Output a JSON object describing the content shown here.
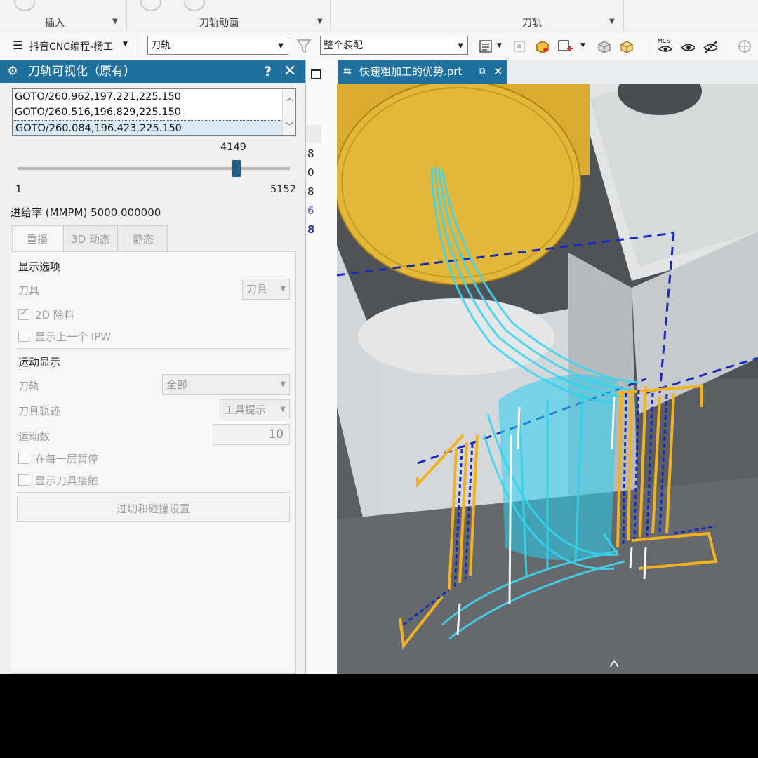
{
  "ribbon": {
    "group_insert": "插入",
    "group_animation": "刀轨动画",
    "group_toolpath": "刀轨"
  },
  "toolbar": {
    "menu_label": "抖音CNC编程-杨工",
    "filter_select": "刀轨",
    "scope_select": "整个装配"
  },
  "dialog": {
    "title": "刀轨可视化（原有）",
    "goto_rows": [
      "GOTO/260.962,197.221,225.150",
      "GOTO/260.516,196.829,225.150",
      "GOTO/260.084,196.423,225.150"
    ],
    "slider": {
      "value": 4149,
      "min": 1,
      "max": 5152
    },
    "feedrate": "进给率 (MMPM) 5000.000000",
    "tabs": [
      "重播",
      "3D 动态",
      "静态"
    ],
    "display_options": {
      "section": "显示选项",
      "tool_label": "刀具",
      "tool_value": "刀具",
      "cb_2d_removal": "2D 除料",
      "cb_prev_ipw": "显示上一个 IPW"
    },
    "motion_display": {
      "section": "运动显示",
      "toolpath_label": "刀轨",
      "toolpath_value": "全部",
      "trace_label": "刀具轨迹",
      "trace_value": "工具提示",
      "count_label": "运动数",
      "count_value": "10",
      "cb_pause_layer": "在每一层暂停",
      "cb_tool_contact": "显示刀具接触"
    },
    "gouge_button": "过切和碰撞设置"
  },
  "navigator_numbers": [
    "8",
    "0",
    "8",
    "6",
    "8"
  ],
  "viewport": {
    "tab_name": "快速粗加工的优势.prt"
  },
  "colors": {
    "title_bar": "#1f6f9f",
    "toolpath_cyan": "#3fd6f0",
    "toolpath_yellow": "#f2b21e",
    "toolpath_blue_dashed": "#1a2bb8",
    "part_grey": "#d8dcdd",
    "tool_yellow": "#e2b634"
  }
}
